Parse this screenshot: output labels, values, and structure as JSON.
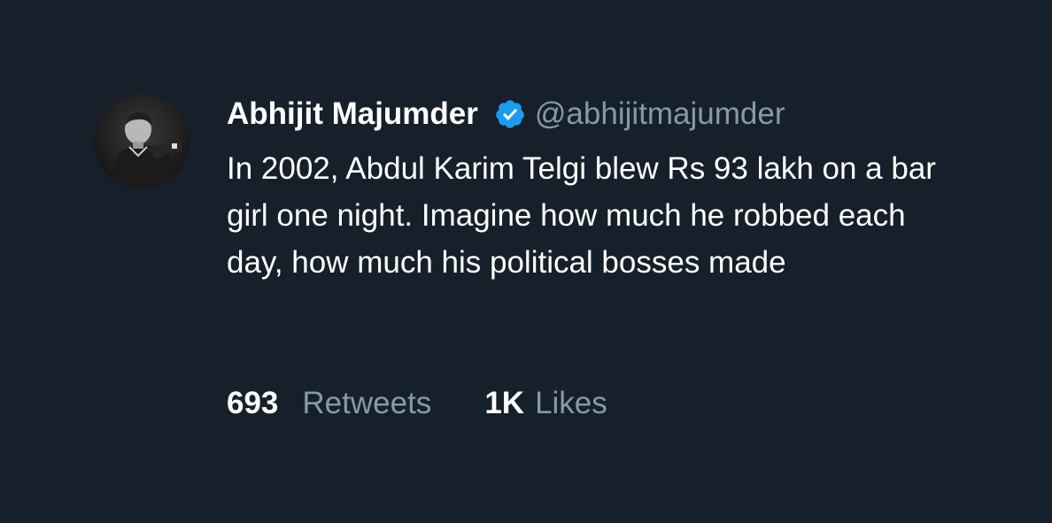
{
  "author": {
    "display_name": "Abhijit Majumder",
    "handle": "@abhijitmajumder",
    "verified": true
  },
  "tweet": {
    "text": "In 2002, Abdul Karim Telgi blew Rs 93 lakh on a bar girl one night. Imagine how much he robbed each day, how much his political bosses made"
  },
  "stats": {
    "retweets_count": "693",
    "retweets_label": "Retweets",
    "likes_count": "1K",
    "likes_label": "Likes"
  },
  "colors": {
    "background": "#16202a",
    "primary_text": "#ffffff",
    "secondary_text": "#8899a6",
    "verified_badge": "#1d9bf0"
  },
  "icons": {
    "verified": "verified-badge-icon"
  }
}
